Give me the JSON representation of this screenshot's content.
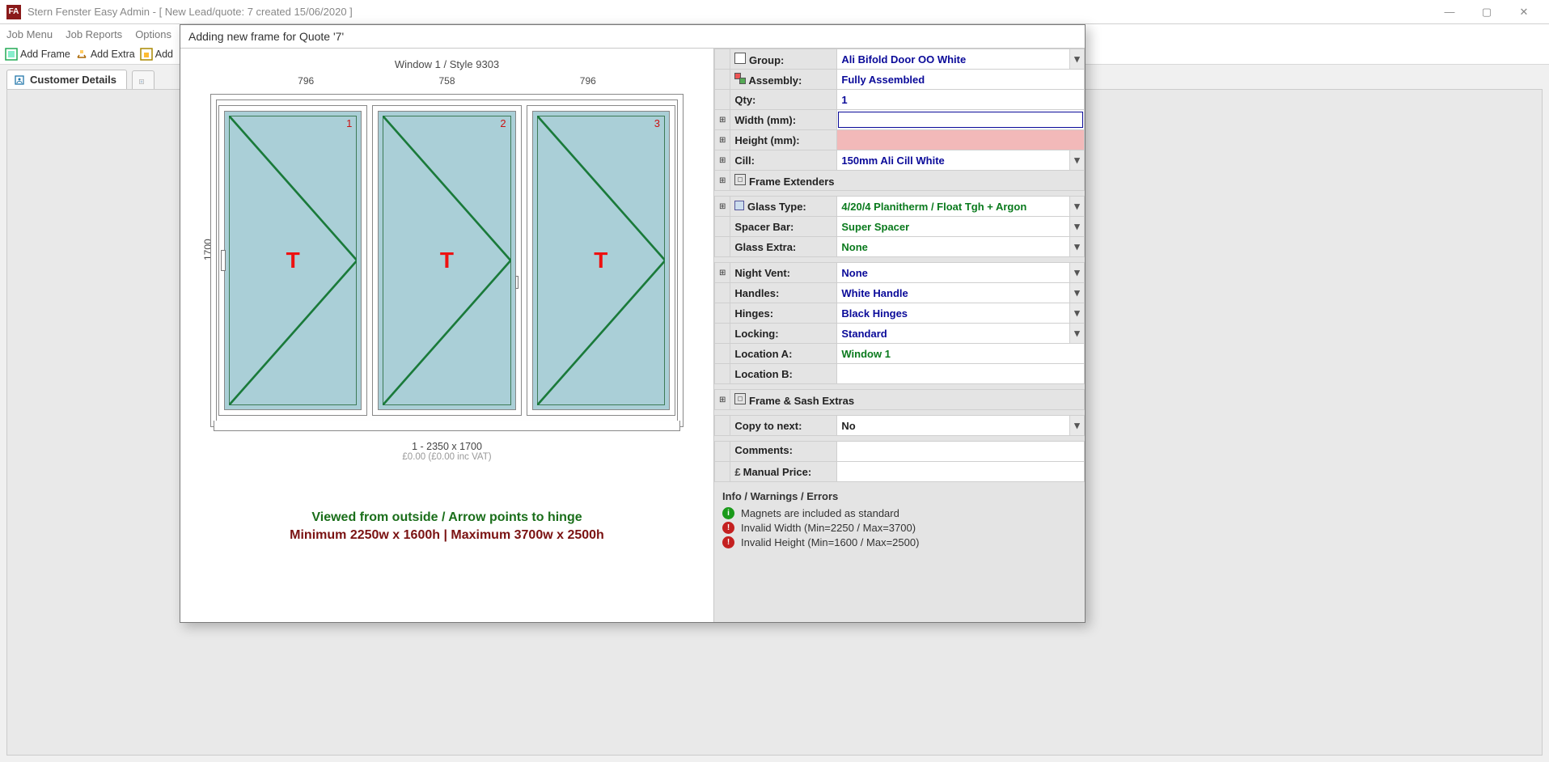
{
  "titlebar": {
    "title": "Stern Fenster Easy Admin - [ New Lead/quote: 7 created 15/06/2020 ]"
  },
  "menubar": {
    "items": [
      "Job Menu",
      "Job Reports",
      "Options"
    ]
  },
  "toolbar": {
    "addFrame": "Add Frame",
    "addExtra": "Add Extra",
    "add": "Add"
  },
  "doctabs": {
    "customer": "Customer Details"
  },
  "dialog": {
    "title": "Adding new frame for Quote '7'"
  },
  "preview": {
    "header": "Window 1 / Style 9303",
    "topDims": [
      "796",
      "758",
      "796"
    ],
    "heightLabel": "1700",
    "panes": [
      {
        "num": "1",
        "t": "T"
      },
      {
        "num": "2",
        "t": "T"
      },
      {
        "num": "3",
        "t": "T"
      }
    ],
    "bottomLine1": "1 - 2350 x 1700",
    "bottomLine2": "£0.00 (£0.00 inc VAT)",
    "viewNote": "Viewed from outside / Arrow points to hinge",
    "minmax": "Minimum 2250w x 1600h | Maximum 3700w x 2500h"
  },
  "form": {
    "group": {
      "label": "Group:",
      "value": "Ali Bifold Door OO White"
    },
    "assembly": {
      "label": "Assembly:",
      "value": "Fully Assembled"
    },
    "qty": {
      "label": "Qty:",
      "value": "1"
    },
    "width": {
      "label": "Width (mm):",
      "value": ""
    },
    "height": {
      "label": "Height (mm):",
      "value": ""
    },
    "cill": {
      "label": "Cill:",
      "value": "150mm Ali Cill White"
    },
    "frameExtenders": {
      "label": "Frame Extenders"
    },
    "glassType": {
      "label": "Glass Type:",
      "value": "4/20/4 Planitherm / Float Tgh + Argon"
    },
    "spacerBar": {
      "label": "Spacer Bar:",
      "value": "Super Spacer"
    },
    "glassExtra": {
      "label": "Glass Extra:",
      "value": "None"
    },
    "nightVent": {
      "label": "Night Vent:",
      "value": "None"
    },
    "handles": {
      "label": "Handles:",
      "value": "White Handle"
    },
    "hinges": {
      "label": "Hinges:",
      "value": "Black Hinges"
    },
    "locking": {
      "label": "Locking:",
      "value": "Standard"
    },
    "locationA": {
      "label": "Location A:",
      "value": "Window 1"
    },
    "locationB": {
      "label": "Location B:",
      "value": ""
    },
    "frameSashExtras": {
      "label": "Frame & Sash Extras"
    },
    "copyToNext": {
      "label": "Copy to next:",
      "value": "No"
    },
    "comments": {
      "label": "Comments:"
    },
    "manualPrice": {
      "label": "Manual Price:"
    }
  },
  "info": {
    "title": "Info / Warnings / Errors",
    "rows": [
      {
        "type": "ok",
        "text": "Magnets are included as standard"
      },
      {
        "type": "err",
        "text": "Invalid Width (Min=2250 / Max=3700)"
      },
      {
        "type": "err",
        "text": "Invalid Height (Min=1600 / Max=2500)"
      }
    ]
  }
}
